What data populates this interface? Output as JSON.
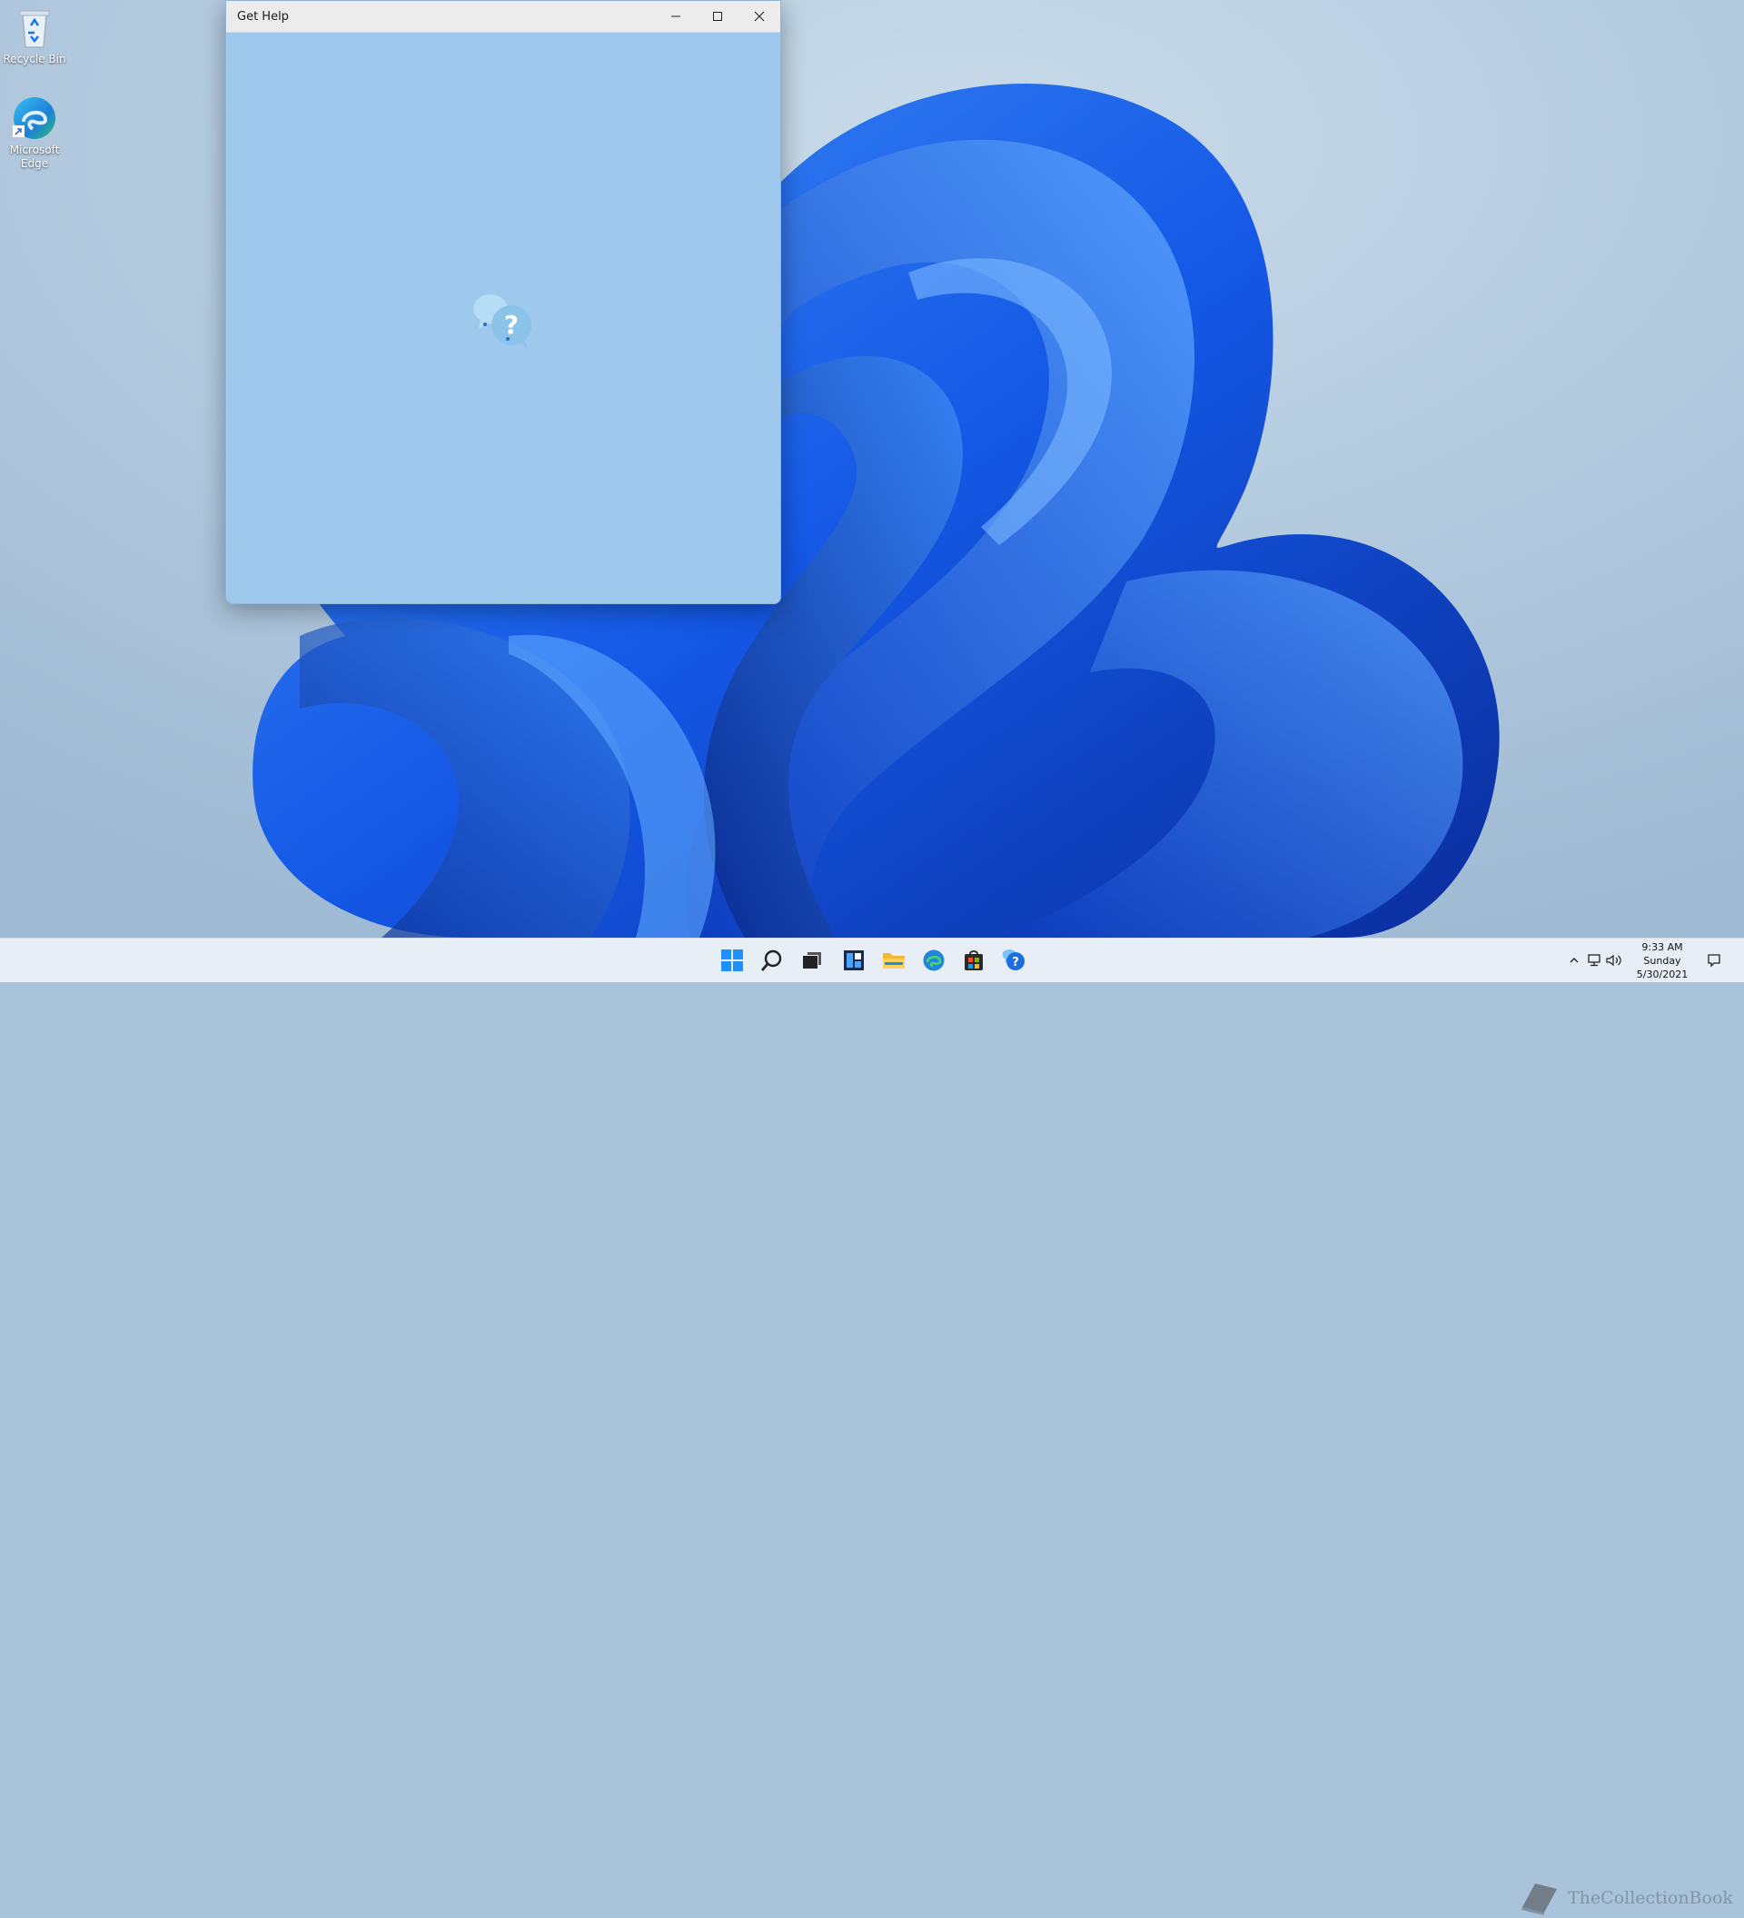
{
  "desktop": {
    "icons": [
      {
        "label": "Recycle Bin"
      },
      {
        "label": "Microsoft Edge"
      }
    ]
  },
  "window": {
    "title": "Get Help",
    "controls": [
      "minimize",
      "maximize",
      "close"
    ],
    "loading_icon": "get-help-chat-icon",
    "background_color": "#9fc9ec"
  },
  "taskbar": {
    "apps": [
      {
        "name": "start-icon"
      },
      {
        "name": "search-icon"
      },
      {
        "name": "task-view-icon"
      },
      {
        "name": "widgets-icon"
      },
      {
        "name": "file-explorer-icon"
      },
      {
        "name": "edge-icon"
      },
      {
        "name": "store-icon"
      },
      {
        "name": "get-help-icon"
      }
    ],
    "tray": [
      "chevron-up-icon",
      "network-icon",
      "volume-icon"
    ],
    "clock": {
      "time": "9:33 AM",
      "day": "Sunday",
      "date": "5/30/2021"
    },
    "watermark": "TheCollectionBook"
  },
  "colors": {
    "accent": "#0a5ad6",
    "taskbar": "#e8eef6"
  }
}
